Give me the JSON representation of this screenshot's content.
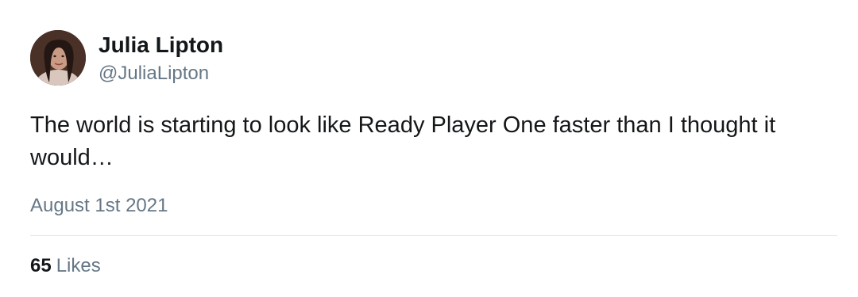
{
  "tweet": {
    "author": {
      "name": "Julia Lipton",
      "handle": "@JuliaLipton"
    },
    "text": "The world is starting to look like Ready Player One faster than I thought it would…",
    "date": "August 1st 2021",
    "likes": {
      "count": "65",
      "label": "Likes"
    }
  },
  "colors": {
    "primary_text": "#14171a",
    "secondary_text": "#657786",
    "divider": "#e1e8ed",
    "background": "#ffffff"
  },
  "icons": {
    "avatar": "profile-photo"
  }
}
